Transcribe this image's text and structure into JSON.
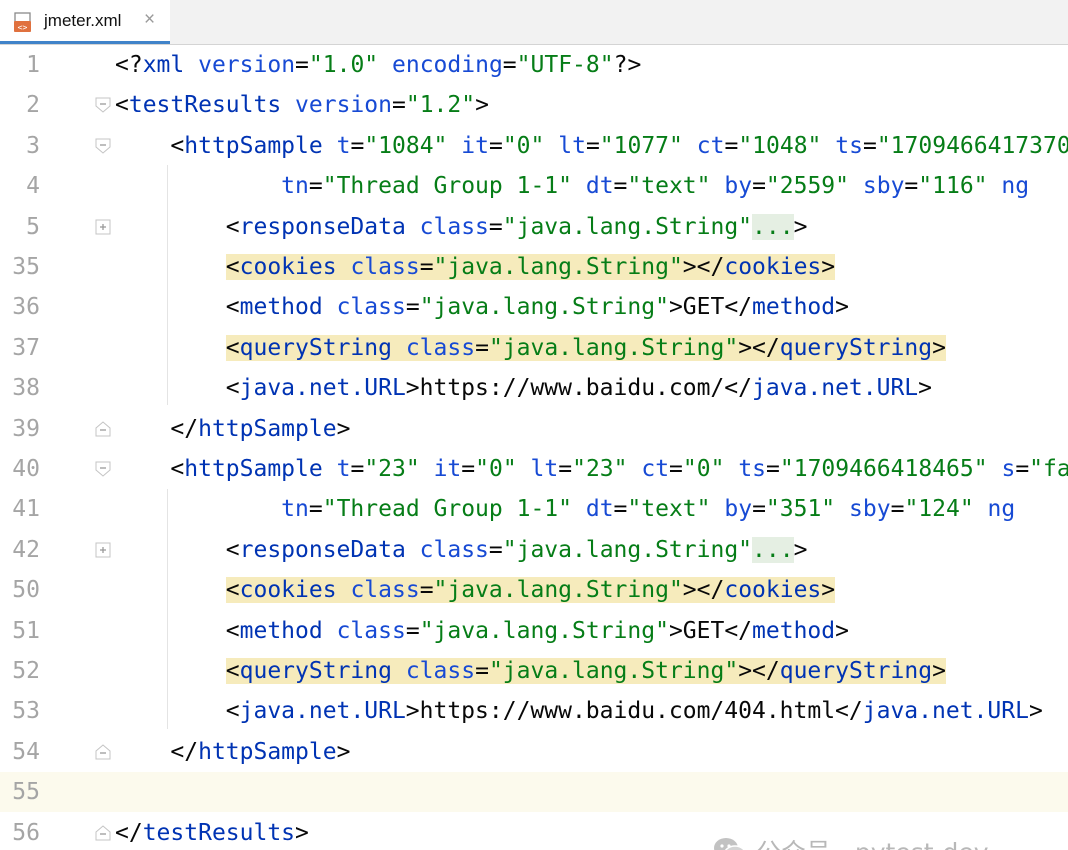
{
  "tab": {
    "filename": "jmeter.xml",
    "close_glyph": "×",
    "icon": "xml-file-icon"
  },
  "editor": {
    "lines": [
      {
        "num": "1",
        "fold": "none",
        "tokens": [
          [
            "b",
            "<?"
          ],
          [
            "t",
            "xml"
          ],
          [
            "b",
            " "
          ],
          [
            "a",
            "version"
          ],
          [
            "b",
            "="
          ],
          [
            "v",
            "\"1.0\""
          ],
          [
            "b",
            " "
          ],
          [
            "a",
            "encoding"
          ],
          [
            "b",
            "="
          ],
          [
            "v",
            "\"UTF-8\""
          ],
          [
            "b",
            "?>"
          ]
        ]
      },
      {
        "num": "2",
        "fold": "open",
        "tokens": [
          [
            "b",
            "<"
          ],
          [
            "t",
            "testResults"
          ],
          [
            "b",
            " "
          ],
          [
            "a",
            "version"
          ],
          [
            "b",
            "="
          ],
          [
            "v",
            "\"1.2\""
          ],
          [
            "b",
            ">"
          ]
        ]
      },
      {
        "num": "3",
        "fold": "open",
        "tokens": [
          [
            "b",
            "    <"
          ],
          [
            "t",
            "httpSample"
          ],
          [
            "b",
            " "
          ],
          [
            "a",
            "t"
          ],
          [
            "b",
            "="
          ],
          [
            "v",
            "\"1084\""
          ],
          [
            "b",
            " "
          ],
          [
            "a",
            "it"
          ],
          [
            "b",
            "="
          ],
          [
            "v",
            "\"0\""
          ],
          [
            "b",
            " "
          ],
          [
            "a",
            "lt"
          ],
          [
            "b",
            "="
          ],
          [
            "v",
            "\"1077\""
          ],
          [
            "b",
            " "
          ],
          [
            "a",
            "ct"
          ],
          [
            "b",
            "="
          ],
          [
            "v",
            "\"1048\""
          ],
          [
            "b",
            " "
          ],
          [
            "a",
            "ts"
          ],
          [
            "b",
            "="
          ],
          [
            "v",
            "\"1709466417370\""
          ]
        ]
      },
      {
        "num": "4",
        "fold": "none",
        "tokens": [
          [
            "b",
            "            "
          ],
          [
            "a",
            "tn"
          ],
          [
            "b",
            "="
          ],
          [
            "v",
            "\"Thread Group 1-1\""
          ],
          [
            "b",
            " "
          ],
          [
            "a",
            "dt"
          ],
          [
            "b",
            "="
          ],
          [
            "v",
            "\"text\""
          ],
          [
            "b",
            " "
          ],
          [
            "a",
            "by"
          ],
          [
            "b",
            "="
          ],
          [
            "v",
            "\"2559\""
          ],
          [
            "b",
            " "
          ],
          [
            "a",
            "sby"
          ],
          [
            "b",
            "="
          ],
          [
            "v",
            "\"116\""
          ],
          [
            "b",
            " "
          ],
          [
            "a",
            "ng"
          ]
        ]
      },
      {
        "num": "5",
        "fold": "closed",
        "tokens": [
          [
            "b",
            "        <"
          ],
          [
            "t",
            "responseData"
          ],
          [
            "b",
            " "
          ],
          [
            "a",
            "class"
          ],
          [
            "b",
            "="
          ],
          [
            "v",
            "\"java.lang.String\""
          ],
          [
            "fold-ph",
            "..."
          ],
          [
            "b",
            ">"
          ]
        ]
      },
      {
        "num": "35",
        "fold": "none",
        "tokens": [
          [
            "b",
            "        "
          ],
          [
            "hl:b",
            "<"
          ],
          [
            "hl:t",
            "cookies"
          ],
          [
            "hl:b",
            " "
          ],
          [
            "hl:a",
            "class"
          ],
          [
            "hl:b",
            "="
          ],
          [
            "hl:v",
            "\"java.lang.String\""
          ],
          [
            "hl:b",
            "></"
          ],
          [
            "hl:t",
            "cookies"
          ],
          [
            "hl:b",
            ">"
          ]
        ]
      },
      {
        "num": "36",
        "fold": "none",
        "tokens": [
          [
            "b",
            "        <"
          ],
          [
            "t",
            "method"
          ],
          [
            "b",
            " "
          ],
          [
            "a",
            "class"
          ],
          [
            "b",
            "="
          ],
          [
            "v",
            "\"java.lang.String\""
          ],
          [
            "b",
            ">GET</"
          ],
          [
            "t",
            "method"
          ],
          [
            "b",
            ">"
          ]
        ]
      },
      {
        "num": "37",
        "fold": "none",
        "tokens": [
          [
            "b",
            "        "
          ],
          [
            "hl:b",
            "<"
          ],
          [
            "hl:t",
            "queryString"
          ],
          [
            "hl:b",
            " "
          ],
          [
            "hl:a",
            "class"
          ],
          [
            "hl:b",
            "="
          ],
          [
            "hl:v",
            "\"java.lang.String\""
          ],
          [
            "hl:b",
            "></"
          ],
          [
            "hl:t",
            "queryString"
          ],
          [
            "hl:b",
            ">"
          ]
        ]
      },
      {
        "num": "38",
        "fold": "none",
        "tokens": [
          [
            "b",
            "        <"
          ],
          [
            "t",
            "java.net.URL"
          ],
          [
            "b",
            ">https://www.baidu.com/</"
          ],
          [
            "t",
            "java.net.URL"
          ],
          [
            "b",
            ">"
          ]
        ]
      },
      {
        "num": "39",
        "fold": "end",
        "tokens": [
          [
            "b",
            "    </"
          ],
          [
            "t",
            "httpSample"
          ],
          [
            "b",
            ">"
          ]
        ]
      },
      {
        "num": "40",
        "fold": "open",
        "tokens": [
          [
            "b",
            "    <"
          ],
          [
            "t",
            "httpSample"
          ],
          [
            "b",
            " "
          ],
          [
            "a",
            "t"
          ],
          [
            "b",
            "="
          ],
          [
            "v",
            "\"23\""
          ],
          [
            "b",
            " "
          ],
          [
            "a",
            "it"
          ],
          [
            "b",
            "="
          ],
          [
            "v",
            "\"0\""
          ],
          [
            "b",
            " "
          ],
          [
            "a",
            "lt"
          ],
          [
            "b",
            "="
          ],
          [
            "v",
            "\"23\""
          ],
          [
            "b",
            " "
          ],
          [
            "a",
            "ct"
          ],
          [
            "b",
            "="
          ],
          [
            "v",
            "\"0\""
          ],
          [
            "b",
            " "
          ],
          [
            "a",
            "ts"
          ],
          [
            "b",
            "="
          ],
          [
            "v",
            "\"1709466418465\""
          ],
          [
            "b",
            " "
          ],
          [
            "a",
            "s"
          ],
          [
            "b",
            "="
          ],
          [
            "v",
            "\"false\""
          ]
        ]
      },
      {
        "num": "41",
        "fold": "none",
        "tokens": [
          [
            "b",
            "            "
          ],
          [
            "a",
            "tn"
          ],
          [
            "b",
            "="
          ],
          [
            "v",
            "\"Thread Group 1-1\""
          ],
          [
            "b",
            " "
          ],
          [
            "a",
            "dt"
          ],
          [
            "b",
            "="
          ],
          [
            "v",
            "\"text\""
          ],
          [
            "b",
            " "
          ],
          [
            "a",
            "by"
          ],
          [
            "b",
            "="
          ],
          [
            "v",
            "\"351\""
          ],
          [
            "b",
            " "
          ],
          [
            "a",
            "sby"
          ],
          [
            "b",
            "="
          ],
          [
            "v",
            "\"124\""
          ],
          [
            "b",
            " "
          ],
          [
            "a",
            "ng"
          ]
        ]
      },
      {
        "num": "42",
        "fold": "closed",
        "tokens": [
          [
            "b",
            "        <"
          ],
          [
            "t",
            "responseData"
          ],
          [
            "b",
            " "
          ],
          [
            "a",
            "class"
          ],
          [
            "b",
            "="
          ],
          [
            "v",
            "\"java.lang.String\""
          ],
          [
            "fold-ph",
            "..."
          ],
          [
            "b",
            ">"
          ]
        ]
      },
      {
        "num": "50",
        "fold": "none",
        "tokens": [
          [
            "b",
            "        "
          ],
          [
            "hl:b",
            "<"
          ],
          [
            "hl:t",
            "cookies"
          ],
          [
            "hl:b",
            " "
          ],
          [
            "hl:a",
            "class"
          ],
          [
            "hl:b",
            "="
          ],
          [
            "hl:v",
            "\"java.lang.String\""
          ],
          [
            "hl:b",
            "></"
          ],
          [
            "hl:t",
            "cookies"
          ],
          [
            "hl:b",
            ">"
          ]
        ]
      },
      {
        "num": "51",
        "fold": "none",
        "tokens": [
          [
            "b",
            "        <"
          ],
          [
            "t",
            "method"
          ],
          [
            "b",
            " "
          ],
          [
            "a",
            "class"
          ],
          [
            "b",
            "="
          ],
          [
            "v",
            "\"java.lang.String\""
          ],
          [
            "b",
            ">GET</"
          ],
          [
            "t",
            "method"
          ],
          [
            "b",
            ">"
          ]
        ]
      },
      {
        "num": "52",
        "fold": "none",
        "tokens": [
          [
            "b",
            "        "
          ],
          [
            "hl:b",
            "<"
          ],
          [
            "hl:t",
            "queryString"
          ],
          [
            "hl:b",
            " "
          ],
          [
            "hl:a",
            "class"
          ],
          [
            "hl:b",
            "="
          ],
          [
            "hl:v",
            "\"java.lang.String\""
          ],
          [
            "hl:b",
            "></"
          ],
          [
            "hl:t",
            "queryString"
          ],
          [
            "hl:b",
            ">"
          ]
        ]
      },
      {
        "num": "53",
        "fold": "none",
        "tokens": [
          [
            "b",
            "        <"
          ],
          [
            "t",
            "java.net.URL"
          ],
          [
            "b",
            ">https://www.baidu.com/404.html</"
          ],
          [
            "t",
            "java.net.URL"
          ],
          [
            "b",
            ">"
          ]
        ]
      },
      {
        "num": "54",
        "fold": "end",
        "tokens": [
          [
            "b",
            "    </"
          ],
          [
            "t",
            "httpSample"
          ],
          [
            "b",
            ">"
          ]
        ]
      },
      {
        "num": "55",
        "fold": "none",
        "current": true,
        "tokens": []
      },
      {
        "num": "56",
        "fold": "end",
        "tokens": [
          [
            "b",
            "</"
          ],
          [
            "t",
            "testResults"
          ],
          [
            "b",
            ">"
          ]
        ]
      }
    ]
  },
  "watermark": {
    "text": "公众号 · pytest-dev",
    "icon": "wechat-icon"
  }
}
